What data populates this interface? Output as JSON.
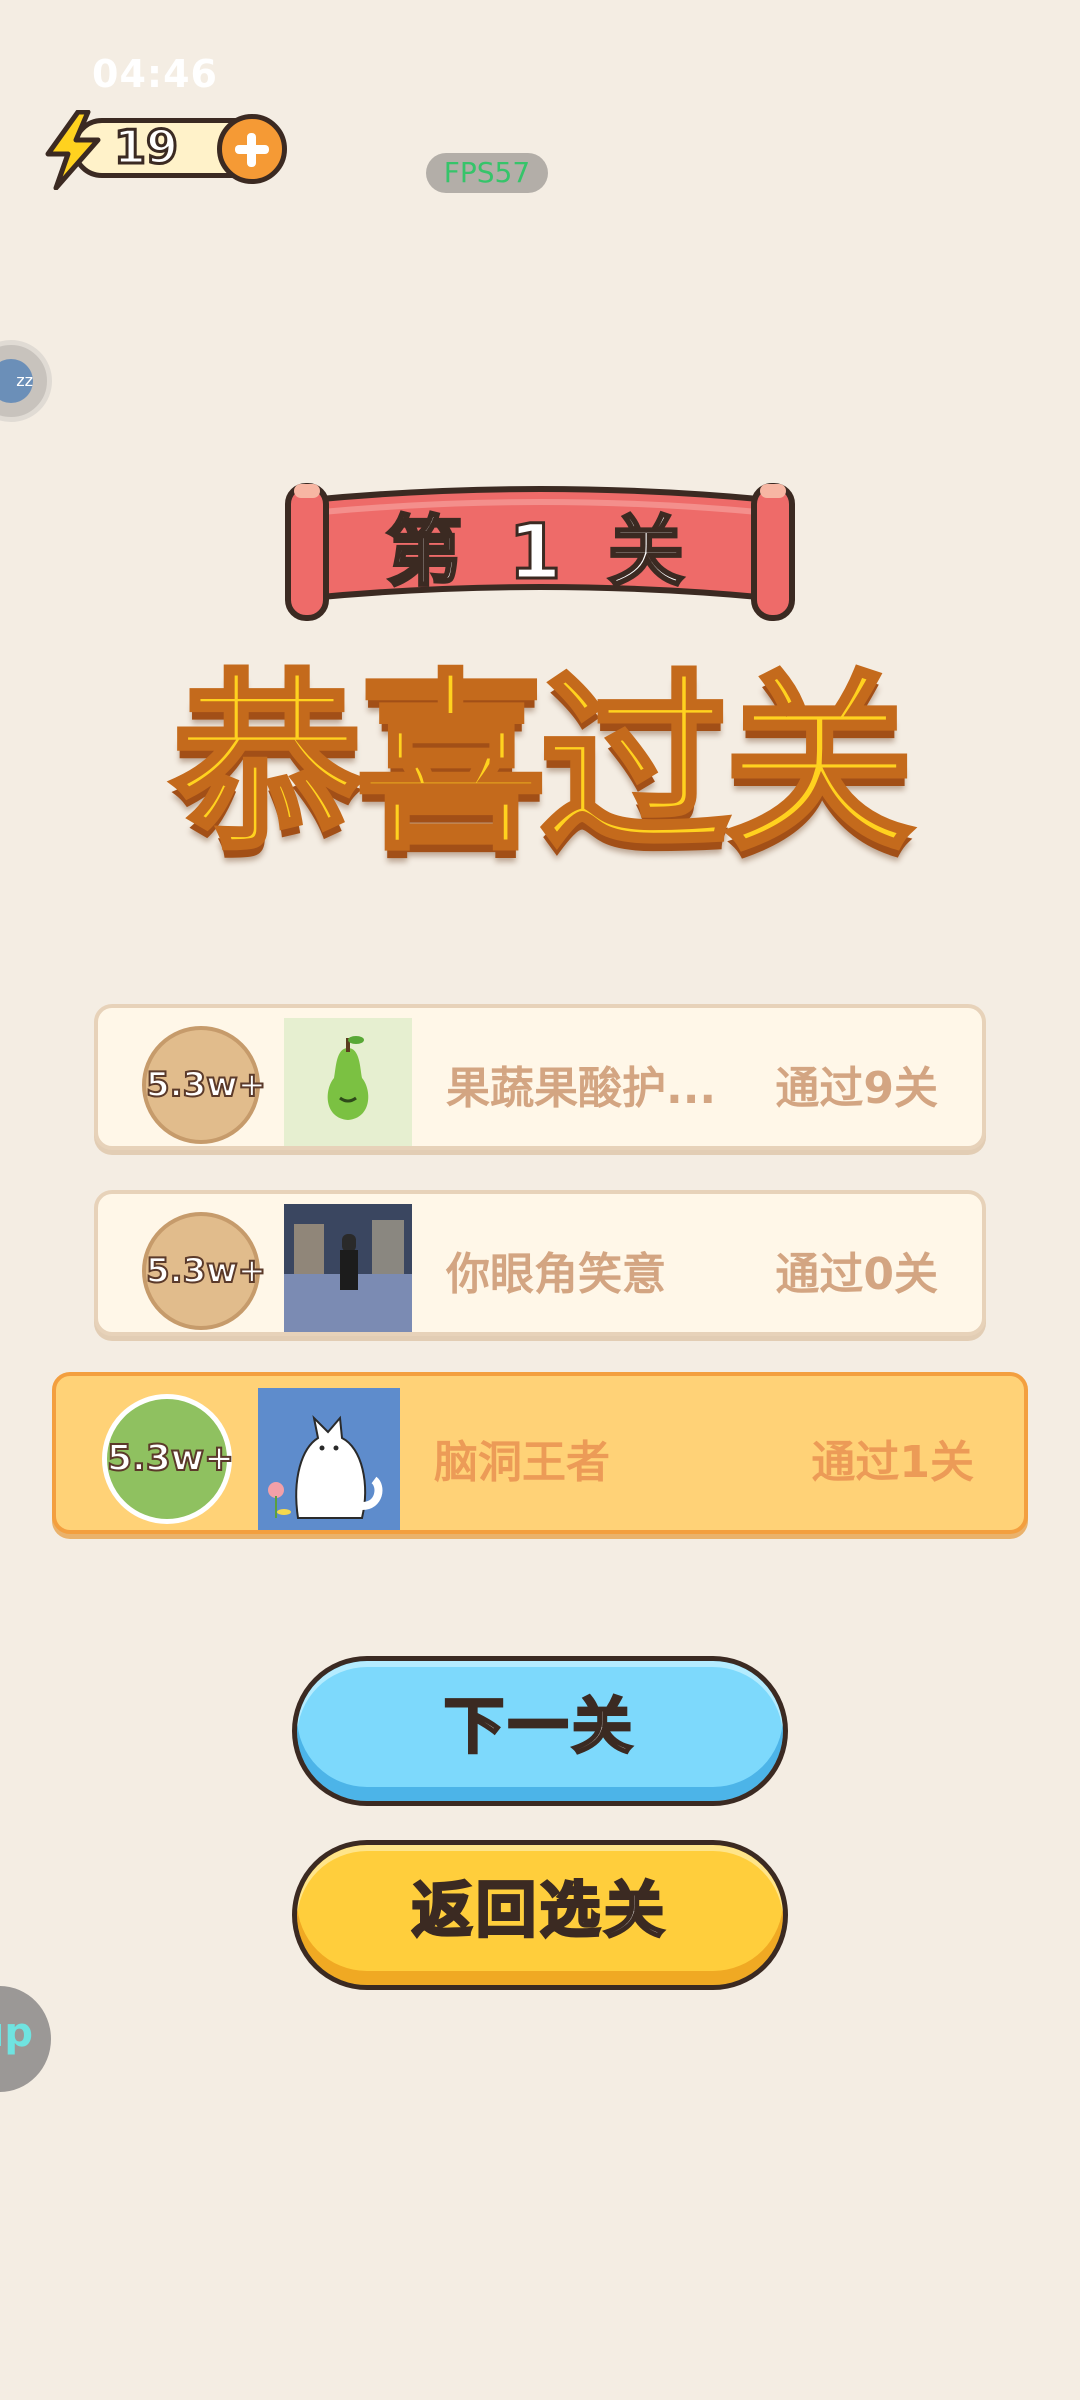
{
  "status": {
    "time": "04:46",
    "fps": "FPS57"
  },
  "energy": {
    "count": "19"
  },
  "side": {
    "bubble_label": "zz",
    "up_label": "up"
  },
  "level": {
    "banner": "第 1 关",
    "title": "恭喜过关"
  },
  "leaderboard": [
    {
      "rank": "5.3w+",
      "name": "果蔬果酸护...",
      "passed": "通过9关",
      "avatar": "pear-avatar"
    },
    {
      "rank": "5.3w+",
      "name": "你眼角笑意",
      "passed": "通过0关",
      "avatar": "person-photo-avatar"
    },
    {
      "rank": "5.3w+",
      "name": "脑洞王者",
      "passed": "通过1关",
      "avatar": "cat-avatar",
      "is_me": true
    }
  ],
  "buttons": {
    "next": "下一关",
    "back": "返回选关"
  },
  "colors": {
    "background": "#f4ede3",
    "accent_orange": "#f59a35",
    "next_blue": "#7dd9fc",
    "back_yellow": "#ffce3c",
    "title_yellow": "#ffd21f",
    "banner_red": "#ee6b69"
  }
}
